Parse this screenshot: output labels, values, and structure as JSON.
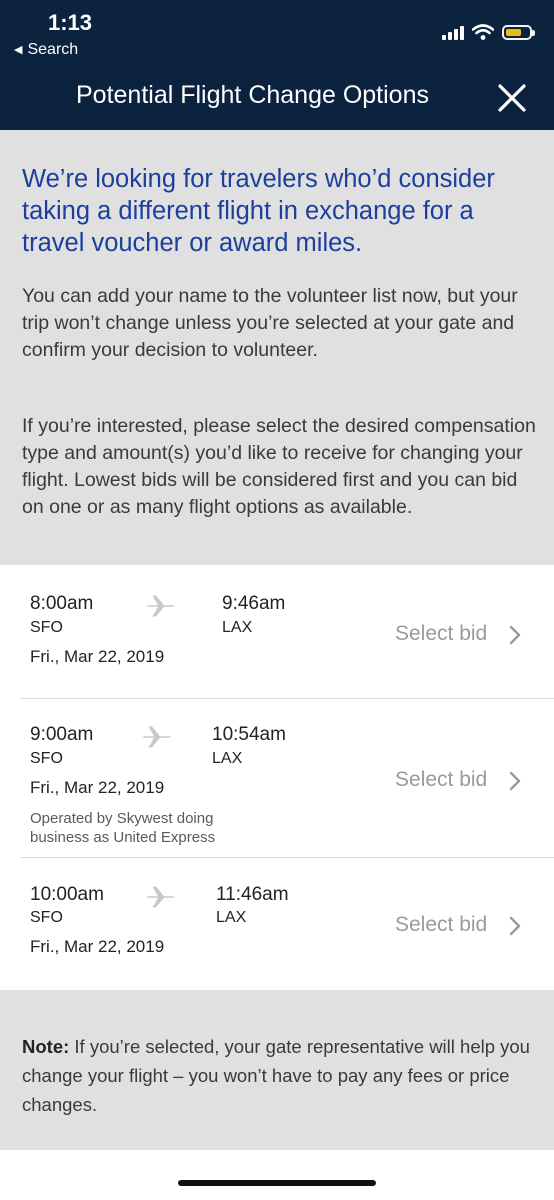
{
  "status_bar": {
    "time": "1:13",
    "back_label": "Search"
  },
  "header": {
    "title": "Potential Flight Change Options"
  },
  "intro": {
    "headline": "We’re looking for travelers who’d consider taking a different flight in exchange for a travel voucher or award miles.",
    "paragraph1": "You can add your name to the volunteer list now, but your trip won’t change unless you’re selected at your gate and confirm your decision to volunteer.",
    "paragraph2": "If you’re interested, please select the desired compensation type and amount(s) you’d like to receive for changing your flight. Lowest bids will be considered first and you can bid on one or as many flight options as available."
  },
  "flights": [
    {
      "depart_time": "8:00am",
      "arrive_time": "9:46am",
      "origin": "SFO",
      "destination": "LAX",
      "date": "Fri., Mar 22, 2019",
      "operator": "",
      "action_label": "Select bid"
    },
    {
      "depart_time": "9:00am",
      "arrive_time": "10:54am",
      "origin": "SFO",
      "destination": "LAX",
      "date": "Fri., Mar 22, 2019",
      "operator": "Operated by Skywest doing business as United Express",
      "action_label": "Select bid"
    },
    {
      "depart_time": "10:00am",
      "arrive_time": "11:46am",
      "origin": "SFO",
      "destination": "LAX",
      "date": "Fri., Mar 22, 2019",
      "operator": "",
      "action_label": "Select bid"
    }
  ],
  "note": {
    "label": "Note:",
    "text": " If you’re selected, your gate representative will help you change your flight – you won’t have to pay any fees or price changes."
  },
  "icons": {
    "close": "close-icon",
    "plane": "airplane-icon",
    "chevron": "chevron-right-icon",
    "back": "back-arrow-icon"
  },
  "colors": {
    "header_bg": "#0c2340",
    "headline_blue": "#1c3f9e",
    "section_gray": "#e0e0e0",
    "battery_yellow": "#f5c518"
  }
}
